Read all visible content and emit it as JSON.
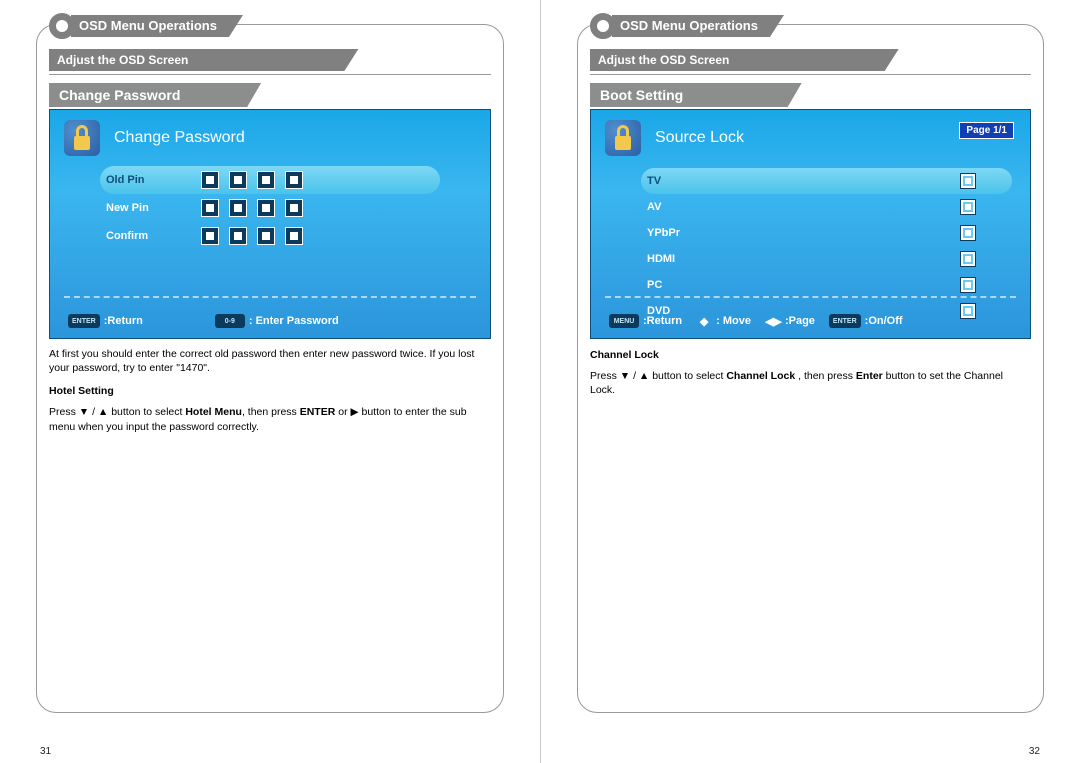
{
  "left": {
    "page_num": "31",
    "header": "OSD Menu Operations",
    "section": "Adjust the OSD Screen",
    "panel_title": "Change Password",
    "osd_title": "Change Password",
    "rows": {
      "old_pin": "Old Pin",
      "new_pin": "New Pin",
      "confirm": "Confirm"
    },
    "footer": {
      "return_key": "ENTER",
      "return_label": ":Return",
      "enter_key": "0-9",
      "enter_label": ": Enter Password"
    },
    "instr1": "At first you should enter the correct old password  then enter new password twice. If you lost your password, try to enter \"1470\".",
    "hotel_head": "Hotel Setting",
    "instr2a": "Press ▼ / ▲ button to select ",
    "instr2b": "Hotel Menu",
    "instr2c": ",  then press  ",
    "instr2d": "ENTER",
    "instr2e": " or  ▶ button to enter the sub menu when you input the password correctly."
  },
  "right": {
    "page_num": "32",
    "header": "OSD Menu Operations",
    "section": "Adjust the OSD Screen",
    "panel_title": "Boot Setting",
    "osd_title": "Source Lock",
    "page_badge": "Page 1/1",
    "sources": [
      "TV",
      "AV",
      "YPbPr",
      "HDMI",
      "PC",
      "DVD"
    ],
    "footer": {
      "menu_key": "MENU",
      "return_label": ":Return",
      "move_icon": "◆",
      "move_label": ": Move",
      "page_icon": "◀▶",
      "page_label": ":Page",
      "onoff_key": "ENTER",
      "onoff_label": ":On/Off"
    },
    "chlock_head": "Channel Lock",
    "instr1a": "Press ▼ / ▲ button to select ",
    "instr1b": "Channel Lock",
    "instr1c": " ,  then press  ",
    "instr1d": "Enter",
    "instr1e": " button to set the Channel Lock."
  }
}
